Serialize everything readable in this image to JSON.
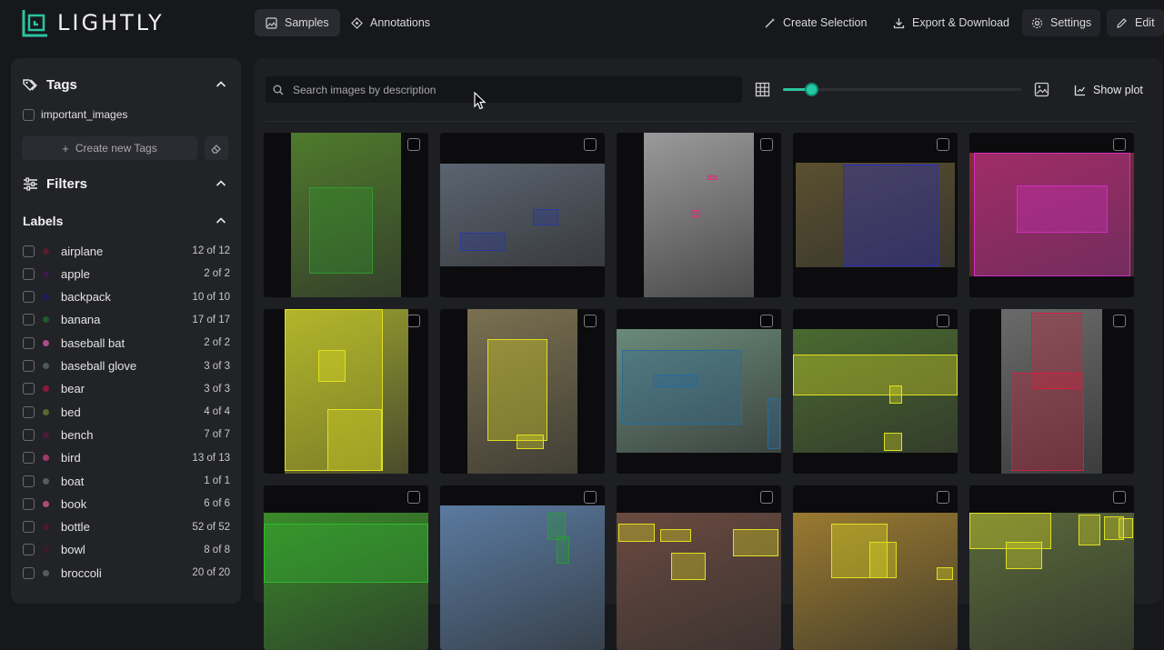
{
  "app": {
    "logo_text": "LIGHTLY",
    "brand_color": "#2bc4a0"
  },
  "nav": {
    "tabs": [
      {
        "label": "Samples",
        "icon": "image-icon",
        "active": true
      },
      {
        "label": "Annotations",
        "icon": "annotation-icon",
        "active": false
      }
    ],
    "actions": [
      {
        "label": "Create Selection",
        "icon": "magic-wand-icon"
      },
      {
        "label": "Export & Download",
        "icon": "download-icon"
      },
      {
        "label": "Settings",
        "icon": "gear-icon"
      },
      {
        "label": "Edit",
        "icon": "pencil-icon"
      }
    ]
  },
  "sidebar": {
    "tags": {
      "title": "Tags",
      "items": [
        {
          "label": "important_images",
          "checked": false
        }
      ],
      "create_label": "Create new Tags"
    },
    "filters": {
      "title": "Filters"
    },
    "labels": {
      "title": "Labels",
      "items": [
        {
          "label": "airplane",
          "count": "12 of 12",
          "color": "#5a1a2a"
        },
        {
          "label": "apple",
          "count": "2 of 2",
          "color": "#3a1a4a"
        },
        {
          "label": "backpack",
          "count": "10 of 10",
          "color": "#1a1a5a"
        },
        {
          "label": "banana",
          "count": "17 of 17",
          "color": "#1f5a2a"
        },
        {
          "label": "baseball bat",
          "count": "2 of 2",
          "color": "#b04a8a"
        },
        {
          "label": "baseball glove",
          "count": "3 of 3",
          "color": "#4a5a55"
        },
        {
          "label": "bear",
          "count": "3 of 3",
          "color": "#8a1a3a"
        },
        {
          "label": "bed",
          "count": "4 of 4",
          "color": "#5a6a2a"
        },
        {
          "label": "bench",
          "count": "7 of 7",
          "color": "#4a1a3a"
        },
        {
          "label": "bird",
          "count": "13 of 13",
          "color": "#a03a6a"
        },
        {
          "label": "boat",
          "count": "1 of 1",
          "color": "#5a5a5a"
        },
        {
          "label": "book",
          "count": "6 of 6",
          "color": "#b04a7a"
        },
        {
          "label": "bottle",
          "count": "52 of 52",
          "color": "#4a1a2a"
        },
        {
          "label": "bowl",
          "count": "8 of 8",
          "color": "#3a1a2a"
        },
        {
          "label": "broccoli",
          "count": "20 of 20",
          "color": "#5a5a5a"
        }
      ]
    }
  },
  "main": {
    "search": {
      "placeholder": "Search images by description",
      "value": ""
    },
    "thumbnail_size": 0.12,
    "show_plot_label": "Show plot"
  },
  "thumbnails": [
    {
      "bg": "#4f7a2c",
      "accent": "#2f9a2f"
    },
    {
      "bg": "#5b6470",
      "accent": "#2a3a9a"
    },
    {
      "bg": "#9a9a9a",
      "accent": "#e0307a"
    },
    {
      "bg": "#5a5030",
      "accent": "#2a2ad0"
    },
    {
      "bg": "#8a2a3a",
      "accent": "#d030c0"
    },
    {
      "bg": "#9aa030",
      "accent": "#e0e020"
    },
    {
      "bg": "#7a7050",
      "accent": "#e0e020"
    },
    {
      "bg": "#6a8a7a",
      "accent": "#2a6a9a"
    },
    {
      "bg": "#4a6a30",
      "accent": "#e0e020"
    },
    {
      "bg": "#6a6a6a",
      "accent": "#d02040"
    },
    {
      "bg": "#3a8a2a",
      "accent": "#2fb82f"
    },
    {
      "bg": "#5a7aa0",
      "accent": "#2a9a3a"
    },
    {
      "bg": "#6a4a40",
      "accent": "#e0e020"
    },
    {
      "bg": "#9a7a30",
      "accent": "#e0e020"
    },
    {
      "bg": "#5a6a3a",
      "accent": "#e0e020"
    }
  ]
}
